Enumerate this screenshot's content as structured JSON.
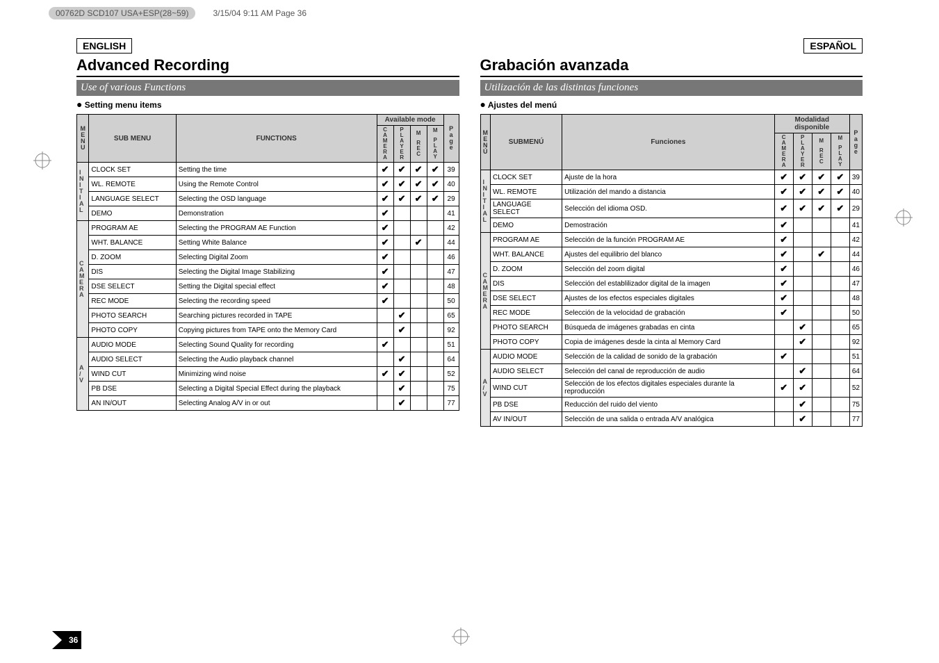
{
  "top_meta": {
    "chip": "00762D SCD107 USA+ESP(28~59)",
    "info": "3/15/04 9:11 AM  Page 36"
  },
  "left": {
    "lang": "ENGLISH",
    "heading": "Advanced Recording",
    "subtitle": "Use of various Functions",
    "settingLabel": "Setting menu items",
    "th_menu": "MENU",
    "th_sub": "SUB MENU",
    "th_func": "FUNCTIONS",
    "th_mode_group": "Available mode",
    "th_cam": "CAMERA",
    "th_player": "PLAYER",
    "th_mrec": "M  REC",
    "th_mplay": "M  PLAY",
    "th_page": "Page"
  },
  "right": {
    "lang": "ESPAÑOL",
    "heading": "Grabación avanzada",
    "subtitle": "Utilización de las distintas funciones",
    "settingLabel": "Ajustes del menú",
    "th_menu": "MENÚ",
    "th_sub": "SUBMENÚ",
    "th_func": "Funciones",
    "th_mode_group": "Modalidad disponible",
    "th_cam": "CAMERA",
    "th_player": "PLAYER",
    "th_mrec": "M  REC",
    "th_mplay": "M  PLAY",
    "th_page": "Page"
  },
  "groups": [
    {
      "id": "INITIAL",
      "label_en": "INITIAL",
      "label_es": "INITIAL",
      "rows": [
        "clock",
        "remote",
        "lang",
        "demo"
      ]
    },
    {
      "id": "CAMERA",
      "label_en": "CAMERA",
      "label_es": "CAMERA",
      "rows": [
        "progae",
        "whtbal",
        "dzoom",
        "dis",
        "dse",
        "recmode",
        "photsearch",
        "photcopy"
      ]
    },
    {
      "id": "AV",
      "label_en": "A/V",
      "label_es": "A/V",
      "rows": [
        "audiomode",
        "audiosel",
        "windcut",
        "pbdse",
        "avinout"
      ]
    }
  ],
  "rows": {
    "clock": {
      "menu": "INITIAL",
      "sub": "CLOCK SET",
      "func_en": "Setting the time",
      "func_es": "Ajuste de la hora",
      "c": "✔",
      "p": "✔",
      "mr": "✔",
      "mp": "✔",
      "pg": "39"
    },
    "remote": {
      "menu": "",
      "sub": "WL. REMOTE",
      "func_en": "Using the Remote Control",
      "func_es": "Utilización del mando a distancia",
      "c": "✔",
      "p": "✔",
      "mr": "✔",
      "mp": "✔",
      "pg": "40"
    },
    "lang": {
      "menu": "",
      "sub": "LANGUAGE SELECT",
      "func_en": "Selecting the OSD language",
      "func_es": "Selección del idioma OSD.",
      "c": "✔",
      "p": "✔",
      "mr": "✔",
      "mp": "✔",
      "pg": "29"
    },
    "demo": {
      "menu": "",
      "sub": "DEMO",
      "func_en": "Demonstration",
      "func_es": "Demostración",
      "c": "✔",
      "p": "",
      "mr": "",
      "mp": "",
      "pg": "41"
    },
    "progae": {
      "menu": "CAMERA",
      "sub": "PROGRAM AE",
      "func_en": "Selecting the PROGRAM AE Function",
      "func_es": "Selección de la función PROGRAM AE",
      "c": "✔",
      "p": "",
      "mr": "",
      "mp": "",
      "pg": "42"
    },
    "whtbal": {
      "menu": "",
      "sub": "WHT. BALANCE",
      "func_en": "Setting White Balance",
      "func_es": "Ajustes del equilibrio del blanco",
      "c": "✔",
      "p": "",
      "mr": "✔",
      "mp": "",
      "pg": "44"
    },
    "dzoom": {
      "menu": "",
      "sub": "D. ZOOM",
      "func_en": "Selecting Digital Zoom",
      "func_es": "Selección del zoom digital",
      "c": "✔",
      "p": "",
      "mr": "",
      "mp": "",
      "pg": "46"
    },
    "dis": {
      "menu": "",
      "sub": "DIS",
      "func_en": "Selecting the Digital Image Stabilizing",
      "func_es": "Selección del establilizador digital de la imagen",
      "c": "✔",
      "p": "",
      "mr": "",
      "mp": "",
      "pg": "47"
    },
    "dse": {
      "menu": "",
      "sub": "DSE SELECT",
      "func_en": "Setting the Digital special effect",
      "func_es": "Ajustes de los efectos especiales digitales",
      "c": "✔",
      "p": "",
      "mr": "",
      "mp": "",
      "pg": "48"
    },
    "recmode": {
      "menu": "",
      "sub": "REC MODE",
      "func_en": "Selecting the recording speed",
      "func_es": "Selección de la velocidad de grabación",
      "c": "✔",
      "p": "",
      "mr": "",
      "mp": "",
      "pg": "50"
    },
    "photsearch": {
      "menu": "",
      "sub": "PHOTO SEARCH",
      "func_en": "Searching pictures recorded in TAPE",
      "func_es": "Búsqueda de imágenes grabadas en cinta",
      "c": "",
      "p": "✔",
      "mr": "",
      "mp": "",
      "pg": "65"
    },
    "photcopy": {
      "menu": "",
      "sub": "PHOTO COPY",
      "func_en": "Copying pictures from TAPE onto the Memory Card",
      "func_es": "Copia de imágenes desde la cinta al Memory Card",
      "c": "",
      "p": "✔",
      "mr": "",
      "mp": "",
      "pg": "92"
    },
    "audiomode": {
      "menu": "A/V",
      "sub": "AUDIO MODE",
      "func_en": "Selecting Sound Quality for recording",
      "func_es": "Selección de la calidad de sonido de la grabación",
      "c": "✔",
      "p": "",
      "mr": "",
      "mp": "",
      "pg": "51"
    },
    "audiosel": {
      "menu": "",
      "sub": "AUDIO SELECT",
      "func_en": "Selecting the Audio playback channel",
      "func_es": "Selección del canal de reproducción de audio",
      "c": "",
      "p": "✔",
      "mr": "",
      "mp": "",
      "pg": "64"
    },
    "windcut": {
      "menu": "",
      "sub": "WIND CUT",
      "func_en": "Minimizing wind noise",
      "func_es": "Selección de los efectos digitales especiales durante la reproducción",
      "c": "✔",
      "p": "✔",
      "mr": "",
      "mp": "",
      "pg": "52"
    },
    "pbdse": {
      "menu": "",
      "sub": "PB DSE",
      "func_en": "Selecting a Digital Special Effect during the playback",
      "func_es": "Reducción del ruido del viento",
      "c": "",
      "p": "✔",
      "mr": "",
      "mp": "",
      "pg": "75"
    },
    "avinout": {
      "menu": "",
      "sub": "AN IN/OUT",
      "sub_es": "AV IN/OUT",
      "func_en": "Selecting Analog A/V in or out",
      "func_es": "Selección de una salida o entrada A/V analógica",
      "c": "",
      "p": "✔",
      "mr": "",
      "mp": "",
      "pg": "77"
    }
  },
  "page_number": "36"
}
